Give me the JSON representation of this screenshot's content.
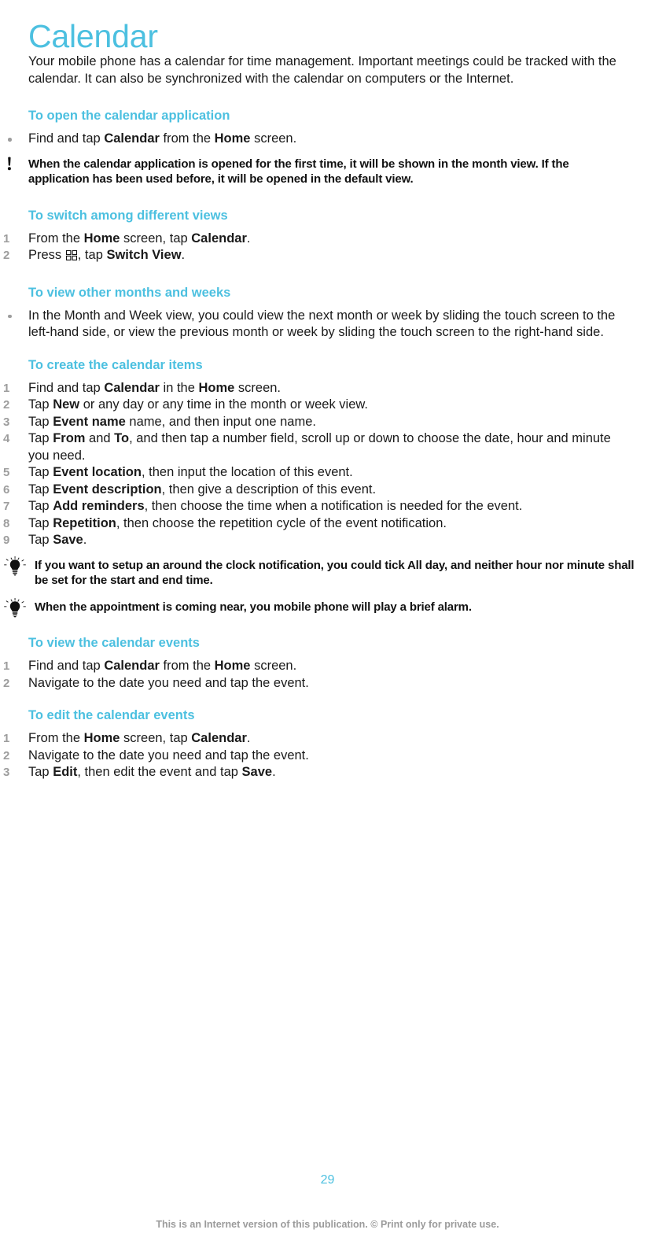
{
  "document": {
    "title": "Calendar",
    "title_color": "#4cc0e0",
    "intro": "Your mobile phone has a calendar for time management. Important meetings could be tracked with the calendar. It can also be synchronized with the calendar on computers or the Internet."
  },
  "sections": {
    "open_app": {
      "heading": "To open the calendar application",
      "bullet_1_a": "Find and tap ",
      "bullet_1_b": "Calendar",
      "bullet_1_c": " from the ",
      "bullet_1_d": "Home",
      "bullet_1_e": " screen.",
      "note": "When the calendar application is opened for the first time, it will be shown in the month view. If the application has been used before, it will be opened in the default view."
    },
    "switch_views": {
      "heading": "To switch among different views",
      "step_1_a": "From the ",
      "step_1_b": "Home",
      "step_1_c": " screen, tap ",
      "step_1_d": "Calendar",
      "step_1_e": ".",
      "step_2_a": "Press ",
      "step_2_b": ", tap ",
      "step_2_c": "Switch View",
      "step_2_d": ".",
      "step_numbers": [
        "1",
        "2"
      ]
    },
    "other_months": {
      "heading": "To view other months and weeks",
      "bullet_1": "In the Month and Week view, you could view the next month or week by sliding the touch screen to the left-hand side, or view the previous month or week by sliding the touch screen to the right-hand side."
    },
    "create_items": {
      "heading": "To create the calendar items",
      "numbers": [
        "1",
        "2",
        "3",
        "4",
        "5",
        "6",
        "7",
        "8",
        "9"
      ],
      "step_1_a": "Find and tap ",
      "step_1_b": "Calendar",
      "step_1_c": " in the ",
      "step_1_d": "Home",
      "step_1_e": " screen.",
      "step_2_a": "Tap ",
      "step_2_b": "New",
      "step_2_c": " or any day or any time in the month or week view.",
      "step_3_a": "Tap ",
      "step_3_b": "Event name",
      "step_3_c": " name, and then input one name.",
      "step_4_a": "Tap ",
      "step_4_b": "From",
      "step_4_c": " and ",
      "step_4_d": "To",
      "step_4_e": ", and then tap a number field, scroll up or down to choose the date, hour and minute you need.",
      "step_5_a": "Tap ",
      "step_5_b": "Event location",
      "step_5_c": ", then input the location of this event.",
      "step_6_a": "Tap ",
      "step_6_b": "Event description",
      "step_6_c": ", then give a description of this event.",
      "step_7_a": "Tap ",
      "step_7_b": "Add reminders",
      "step_7_c": ", then choose the time when a notification is needed for the event.",
      "step_8_a": "Tap ",
      "step_8_b": "Repetition",
      "step_8_c": ", then choose the repetition cycle of the event notification.",
      "step_9_a": "Tap ",
      "step_9_b": "Save",
      "step_9_c": ".",
      "tip_1": "If you want to setup an around the clock notification, you could tick All day, and neither hour nor minute shall be set for the start and end time.",
      "tip_2": "When the appointment is coming near, you mobile phone will play a brief alarm."
    },
    "view_events": {
      "heading": "To view the calendar events",
      "numbers": [
        "1",
        "2"
      ],
      "step_1_a": "Find and tap ",
      "step_1_b": "Calendar",
      "step_1_c": " from the ",
      "step_1_d": "Home",
      "step_1_e": " screen.",
      "step_2": "Navigate to the date you need and tap the event."
    },
    "edit_events": {
      "heading": "To edit the calendar events",
      "numbers": [
        "1",
        "2",
        "3"
      ],
      "step_1_a": "From the ",
      "step_1_b": "Home",
      "step_1_c": " screen, tap ",
      "step_1_d": "Calendar",
      "step_1_e": ".",
      "step_2": "Navigate to the date you need and tap the event.",
      "step_3_a": "Tap ",
      "step_3_b": "Edit",
      "step_3_c": ", then edit the event and tap ",
      "step_3_d": "Save",
      "step_3_e": "."
    }
  },
  "footer": {
    "page_number": "29",
    "notice": "This is an Internet version of this publication. © Print only for private use."
  },
  "icons": {
    "note": "exclamation-icon",
    "tip": "lightbulb-icon",
    "menu": "menu-grid-icon"
  }
}
